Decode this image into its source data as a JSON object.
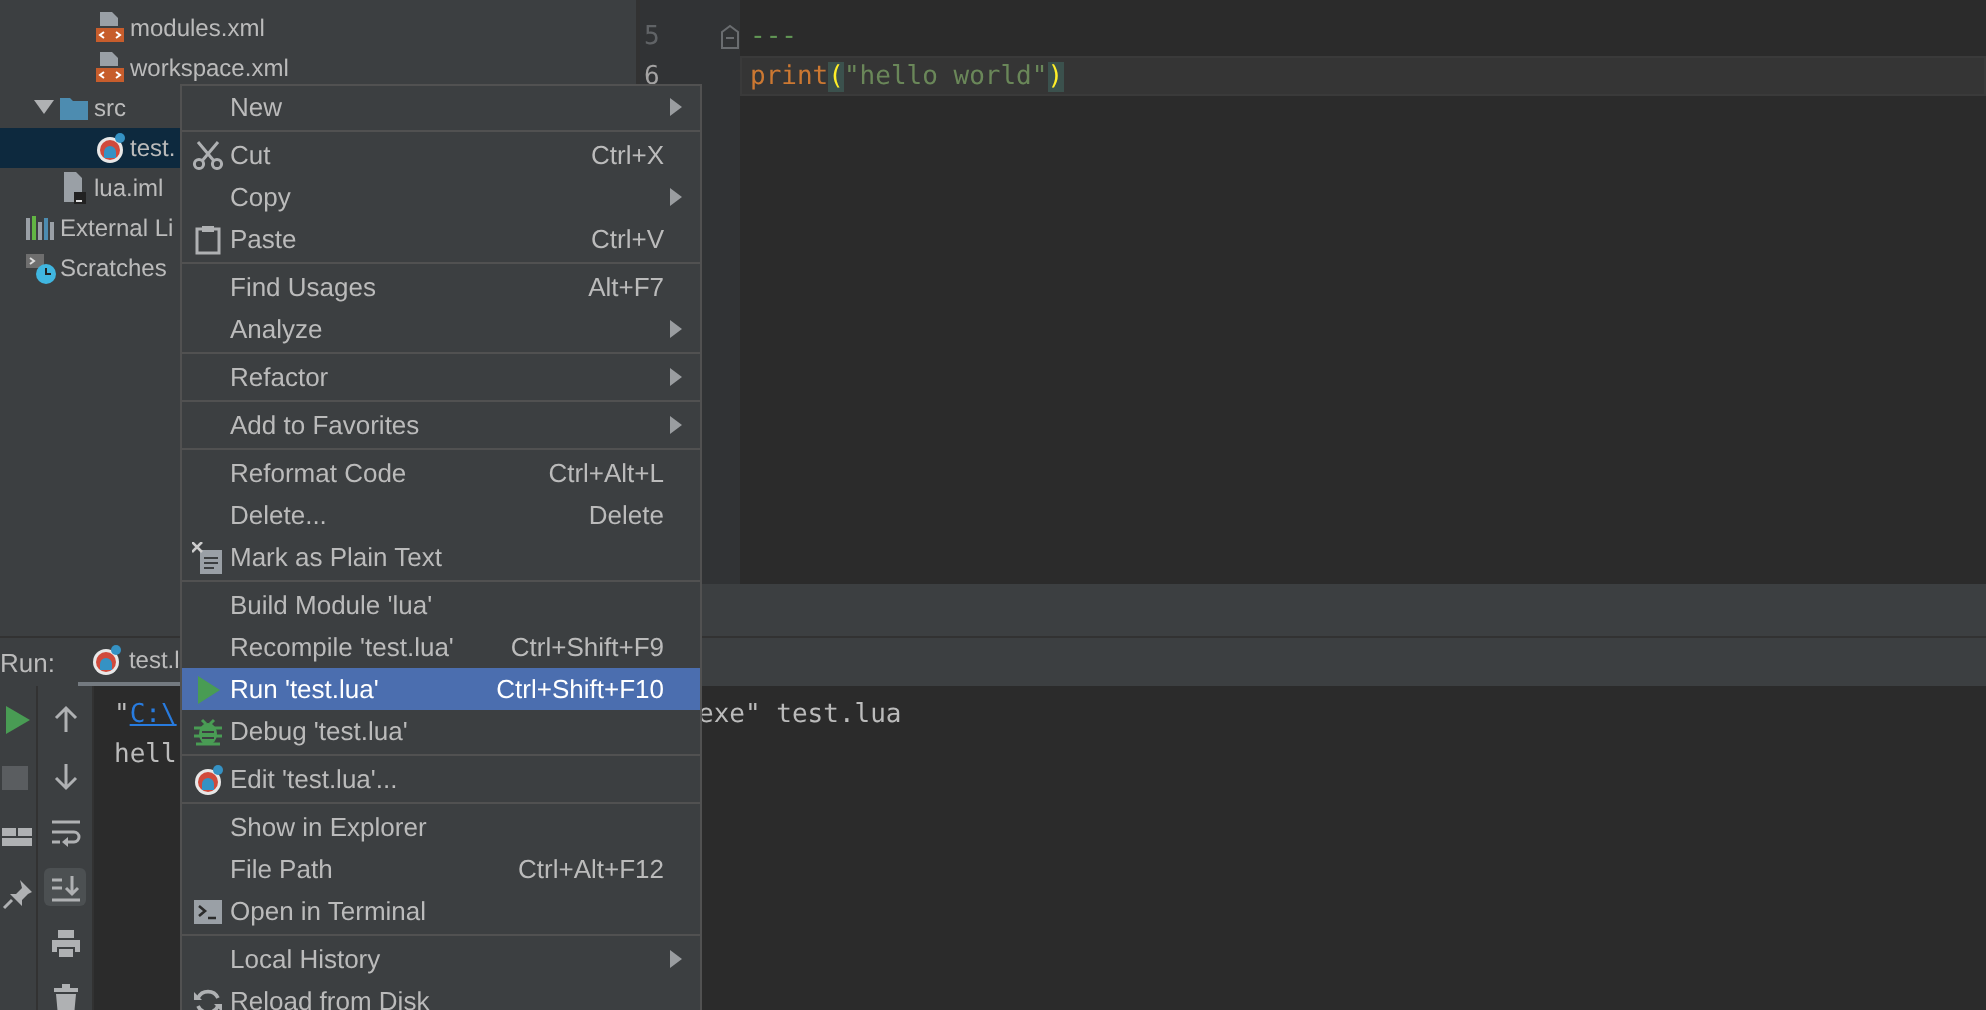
{
  "project_tree": {
    "items": [
      {
        "children": [
          {
            "children": [
              {
                "label": "modules.xml",
                "kind": "xml",
                "selected": false
              },
              {
                "label": "workspace.xml",
                "kind": "xml",
                "selected": false
              }
            ]
          },
          {
            "label": "src",
            "kind": "folder",
            "expanded": true,
            "selected": false,
            "children": [
              {
                "label": "test.",
                "kind": "lua",
                "selected": true
              }
            ]
          },
          {
            "label": "lua.iml",
            "kind": "iml",
            "selected": false
          }
        ]
      },
      {
        "label": "External Li",
        "kind": "libraries",
        "selected": false
      },
      {
        "label": "Scratches",
        "kind": "scratches",
        "selected": false
      }
    ]
  },
  "editor": {
    "lines": [
      {
        "number": "5",
        "fold": true,
        "current": false,
        "tokens": [
          {
            "kind": "comment",
            "text": "---",
            "matched": false
          }
        ]
      },
      {
        "number": "6",
        "fold": false,
        "current": true,
        "tokens": [
          {
            "kind": "function",
            "text": "print",
            "matched": false
          },
          {
            "kind": "paren",
            "text": "(",
            "matched": true
          },
          {
            "kind": "string",
            "text": "\"hello world\"",
            "matched": false
          },
          {
            "kind": "paren",
            "text": ")",
            "matched": true
          }
        ]
      }
    ]
  },
  "run_panel": {
    "label": "Run:",
    "tab": {
      "label": "test.l",
      "selected": true
    },
    "left_toolbar": [
      {
        "kind": "run",
        "on": false
      },
      {
        "kind": "stop",
        "on": false
      },
      {
        "kind": "layout",
        "on": false
      },
      {
        "kind": "pin",
        "on": false
      }
    ],
    "right_toolbar": [
      {
        "kind": "up",
        "on": false
      },
      {
        "kind": "down",
        "on": false
      },
      {
        "kind": "wrap",
        "on": false
      },
      {
        "kind": "scroll-end",
        "on": true
      },
      {
        "kind": "print",
        "on": false
      },
      {
        "kind": "trash",
        "on": false
      }
    ],
    "console": [
      {
        "prefix": "\"",
        "link": "C:\\",
        "tail": "exe\" test.lua"
      },
      {
        "prefix": "hell"
      }
    ]
  },
  "context_menu": {
    "groups": [
      {
        "items": [
          {
            "label": "New",
            "kind": "plain",
            "submenu": true,
            "selected": false
          }
        ]
      },
      {
        "items": [
          {
            "label": "Cut",
            "kind": "cut",
            "shortcut": "Ctrl+X",
            "submenu": false,
            "selected": false
          },
          {
            "label": "Copy",
            "kind": "plain",
            "submenu": true,
            "selected": false
          },
          {
            "label": "Paste",
            "kind": "paste",
            "shortcut": "Ctrl+V",
            "submenu": false,
            "selected": false
          }
        ]
      },
      {
        "items": [
          {
            "label": "Find Usages",
            "kind": "plain",
            "shortcut": "Alt+F7",
            "submenu": false,
            "selected": false
          },
          {
            "label": "Analyze",
            "kind": "plain",
            "submenu": true,
            "selected": false
          }
        ]
      },
      {
        "items": [
          {
            "label": "Refactor",
            "kind": "plain",
            "submenu": true,
            "selected": false
          }
        ]
      },
      {
        "items": [
          {
            "label": "Add to Favorites",
            "kind": "plain",
            "submenu": true,
            "selected": false
          }
        ]
      },
      {
        "items": [
          {
            "label": "Reformat Code",
            "kind": "plain",
            "shortcut": "Ctrl+Alt+L",
            "submenu": false,
            "selected": false
          },
          {
            "label": "Delete...",
            "kind": "plain",
            "shortcut": "Delete",
            "submenu": false,
            "selected": false
          },
          {
            "label": "Mark as Plain Text",
            "kind": "mark-text",
            "submenu": false,
            "selected": false
          }
        ]
      },
      {
        "items": [
          {
            "label": "Build Module 'lua'",
            "kind": "plain",
            "submenu": false,
            "selected": false
          },
          {
            "label": "Recompile 'test.lua'",
            "kind": "plain",
            "shortcut": "Ctrl+Shift+F9",
            "submenu": false,
            "selected": false
          },
          {
            "label": "Run 'test.lua'",
            "kind": "run",
            "shortcut": "Ctrl+Shift+F10",
            "submenu": false,
            "selected": true
          },
          {
            "label": "Debug 'test.lua'",
            "kind": "debug",
            "submenu": false,
            "selected": false
          }
        ]
      },
      {
        "items": [
          {
            "label": "Edit 'test.lua'...",
            "kind": "edit-config",
            "submenu": false,
            "selected": false
          }
        ]
      },
      {
        "items": [
          {
            "label": "Show in Explorer",
            "kind": "plain",
            "submenu": false,
            "selected": false
          },
          {
            "label": "File Path",
            "kind": "plain",
            "shortcut": "Ctrl+Alt+F12",
            "submenu": false,
            "selected": false
          },
          {
            "label": "Open in Terminal",
            "kind": "terminal",
            "submenu": false,
            "selected": false
          }
        ]
      },
      {
        "items": [
          {
            "label": "Local History",
            "kind": "plain",
            "submenu": true,
            "selected": false
          },
          {
            "label": "Reload from Disk",
            "kind": "reload",
            "submenu": false,
            "selected": false
          }
        ]
      }
    ]
  }
}
